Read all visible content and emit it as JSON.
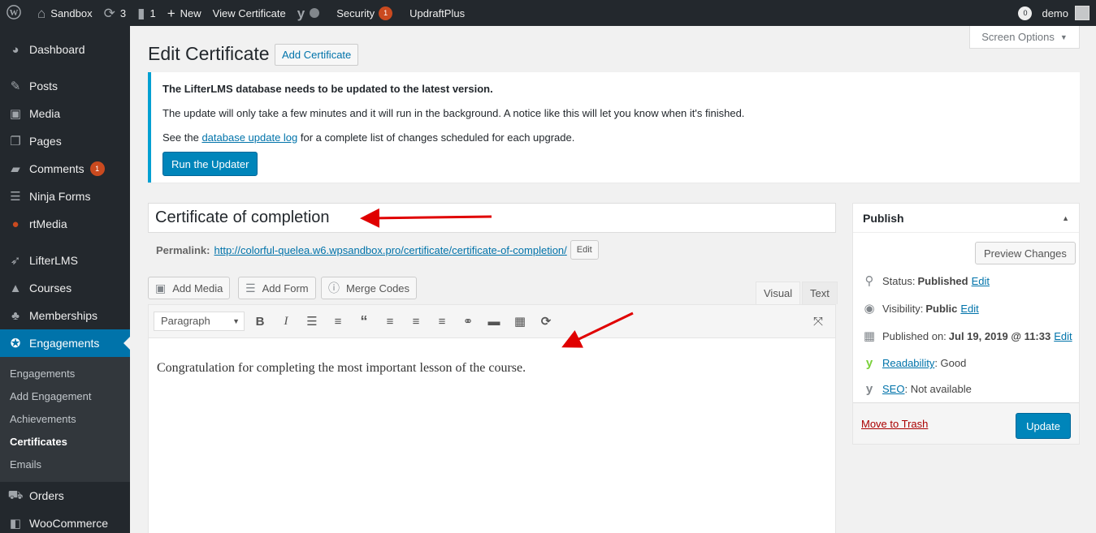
{
  "adminbar": {
    "wp_logo": "wordpress-icon",
    "site_name": "Sandbox",
    "updates_count": "3",
    "comments_count": "1",
    "new_label": "New",
    "view_label": "View Certificate",
    "security_label": "Security",
    "security_count": "1",
    "updraft_label": "UpdraftPlus",
    "notifications_count": "0",
    "user_name": "demo"
  },
  "sidebar": {
    "dashboard": "Dashboard",
    "posts": "Posts",
    "media": "Media",
    "pages": "Pages",
    "comments": "Comments",
    "comments_count": "1",
    "ninja_forms": "Ninja Forms",
    "rtmedia": "rtMedia",
    "lifterlms": "LifterLMS",
    "courses": "Courses",
    "memberships": "Memberships",
    "engagements": "Engagements",
    "sub": {
      "engagements": "Engagements",
      "add_engagement": "Add Engagement",
      "achievements": "Achievements",
      "certificates": "Certificates",
      "emails": "Emails"
    },
    "orders": "Orders",
    "woocommerce": "WooCommerce"
  },
  "screen_options": "Screen Options",
  "page": {
    "title": "Edit Certificate",
    "add_new": "Add Certificate"
  },
  "notice": {
    "heading": "The LifterLMS database needs to be updated to the latest version.",
    "line2": "The update will only take a few minutes and it will run in the background. A notice like this will let you know when it's finished.",
    "line3_before": "See the ",
    "line3_link": "database update log",
    "line3_after": " for a complete list of changes scheduled for each upgrade.",
    "button": "Run the Updater"
  },
  "post": {
    "title": "Certificate of completion",
    "permalink_label": "Permalink:",
    "permalink_base": "http://colorful-quelea.w6.wpsandbox.pro/certificate/",
    "permalink_slug": "certificate-of-completion",
    "permalink_end": "/",
    "edit_slug": "Edit"
  },
  "media_buttons": {
    "add_media": "Add Media",
    "add_form": "Add Form",
    "merge_codes": "Merge Codes"
  },
  "editor": {
    "tab_visual": "Visual",
    "tab_text": "Text",
    "format": "Paragraph",
    "content": "Congratulation for completing the most important lesson of the course."
  },
  "publish": {
    "title": "Publish",
    "preview": "Preview Changes",
    "status_label": "Status:",
    "status_value": "Published",
    "visibility_label": "Visibility:",
    "visibility_value": "Public",
    "published_label": "Published on:",
    "published_value": "Jul 19, 2019 @ 11:33",
    "edit": "Edit",
    "readability_link": "Readability",
    "readability_value": ": Good",
    "seo_link": "SEO",
    "seo_value": ": Not available",
    "trash": "Move to Trash",
    "update": "Update"
  },
  "colors": {
    "admin_dark": "#23282d",
    "accent_blue": "#0073aa",
    "primary_button": "#0085ba",
    "badge_orange": "#ca4a1f",
    "annotation_red": "#e00000"
  }
}
